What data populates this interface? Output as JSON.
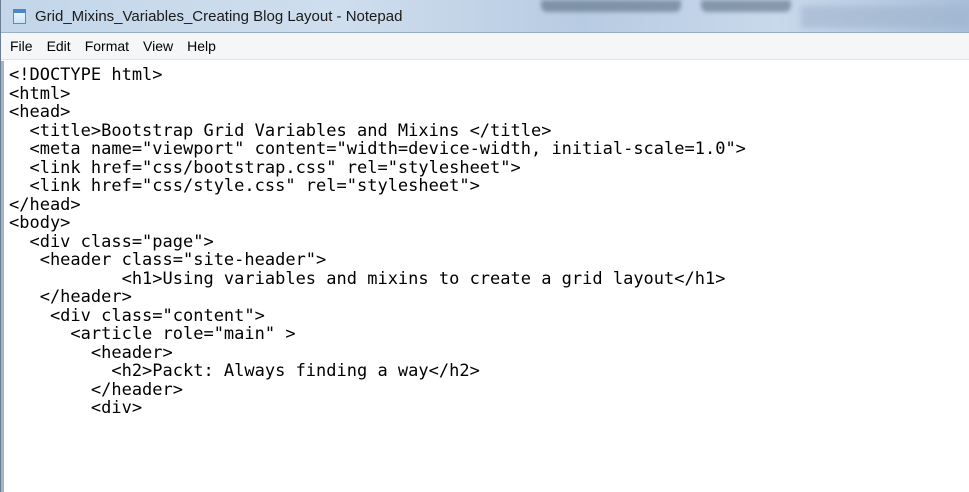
{
  "window": {
    "title": "Grid_Mixins_Variables_Creating Blog Layout - Notepad",
    "icon": "notepad-icon"
  },
  "menu": {
    "items": [
      "File",
      "Edit",
      "Format",
      "View",
      "Help"
    ]
  },
  "editor": {
    "lines": [
      "<!DOCTYPE html>",
      "<html>",
      "<head>",
      "  <title>Bootstrap Grid Variables and Mixins </title>",
      "  <meta name=\"viewport\" content=\"width=device-width, initial-scale=1.0\">",
      "  <link href=\"css/bootstrap.css\" rel=\"stylesheet\">",
      "  <link href=\"css/style.css\" rel=\"stylesheet\">",
      "</head>",
      "<body>",
      "  <div class=\"page\">",
      "   <header class=\"site-header\">",
      "           <h1>Using variables and mixins to create a grid layout</h1>",
      "   </header>",
      "    <div class=\"content\">",
      "      <article role=\"main\" >",
      "        <header>",
      "          <h2>Packt: Always finding a way</h2>",
      "        </header>",
      "        <div>"
    ]
  }
}
